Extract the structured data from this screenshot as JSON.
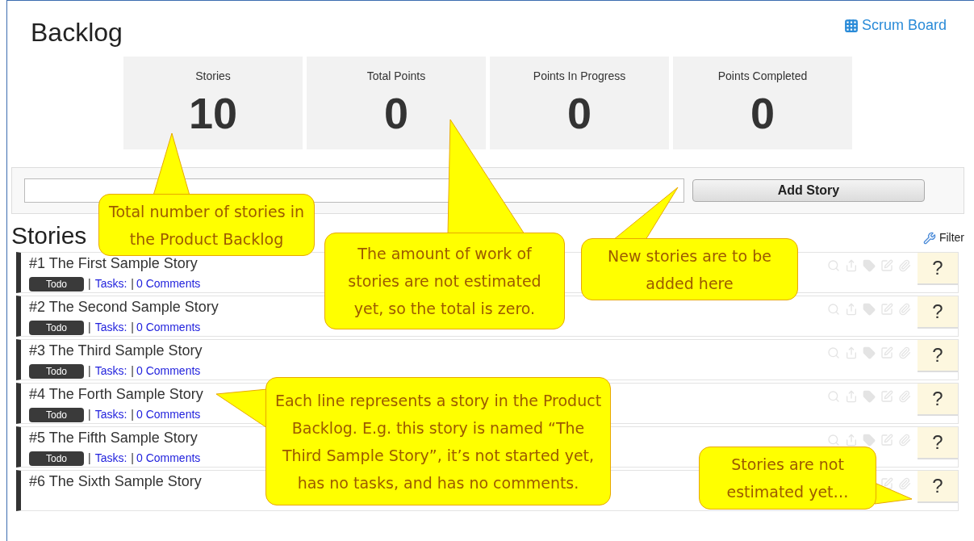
{
  "page": {
    "title": "Backlog",
    "board_link": "Scrum Board"
  },
  "stats": [
    {
      "label": "Stories",
      "value": "10"
    },
    {
      "label": "Total Points",
      "value": "0"
    },
    {
      "label": "Points In Progress",
      "value": "0"
    },
    {
      "label": "Points Completed",
      "value": "0"
    }
  ],
  "add_story": {
    "button": "Add Story"
  },
  "stories_section": {
    "heading": "Stories",
    "filter": "Filter"
  },
  "stories": [
    {
      "title": "#1 The First Sample Story",
      "status": "Todo",
      "sep1": "|",
      "tasks": "Tasks:",
      "sep2": "|",
      "comments": "0 Comments",
      "estimate": "?"
    },
    {
      "title": "#2 The Second Sample Story",
      "status": "Todo",
      "sep1": "|",
      "tasks": "Tasks:",
      "sep2": "|",
      "comments": "0 Comments",
      "estimate": "?"
    },
    {
      "title": "#3 The Third Sample Story",
      "status": "Todo",
      "sep1": "|",
      "tasks": "Tasks:",
      "sep2": "|",
      "comments": "0 Comments",
      "estimate": "?"
    },
    {
      "title": "#4 The Forth Sample Story",
      "status": "Todo",
      "sep1": "|",
      "tasks": "Tasks:",
      "sep2": "|",
      "comments": "0 Comments",
      "estimate": "?"
    },
    {
      "title": "#5 The Fifth Sample Story",
      "status": "Todo",
      "sep1": "|",
      "tasks": "Tasks:",
      "sep2": "|",
      "comments": "0 Comments",
      "estimate": "?"
    },
    {
      "title": "#6 The Sixth Sample Story",
      "estimate": "?"
    }
  ],
  "callouts": [
    {
      "text": "Total number of stories in the Product Backlog"
    },
    {
      "text": "The amount of work of stories are not estimated yet, so the total is zero."
    },
    {
      "text": "New stories are to be added here"
    },
    {
      "text": "Each line represents a story in the Product Backlog. E.g. this story is named “The Third Sample Story”, it’s not started yet, has no tasks, and has no comments."
    },
    {
      "text": "Stories are not estimated yet…"
    }
  ]
}
